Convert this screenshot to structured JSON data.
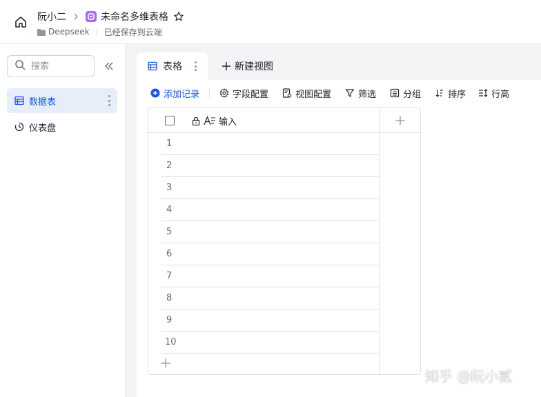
{
  "header": {
    "owner": "阮小二",
    "doc_title": "未命名多维表格",
    "folder": "Deepseek",
    "save_status": "已经保存到云端"
  },
  "sidebar": {
    "search_placeholder": "搜索",
    "items": [
      {
        "label": "数据表",
        "icon": "table-icon",
        "active": true
      },
      {
        "label": "仪表盘",
        "icon": "dashboard-icon",
        "active": false
      }
    ]
  },
  "tabs": [
    {
      "label": "表格",
      "icon": "table-icon",
      "active": true
    }
  ],
  "new_view_label": "新建视图",
  "toolbar": {
    "add_record": "添加记录",
    "field_config": "字段配置",
    "view_config": "视图配置",
    "filter": "筛选",
    "group": "分组",
    "sort": "排序",
    "row_height": "行高"
  },
  "grid": {
    "field_name": "输入",
    "rows": [
      "1",
      "2",
      "3",
      "4",
      "5",
      "6",
      "7",
      "8",
      "9",
      "10"
    ]
  },
  "colors": {
    "accent": "#1456f0",
    "doc_icon": "#a66bf0",
    "sidebar_active_bg": "#e8eef9"
  },
  "watermark": "知乎 @阮小贰"
}
